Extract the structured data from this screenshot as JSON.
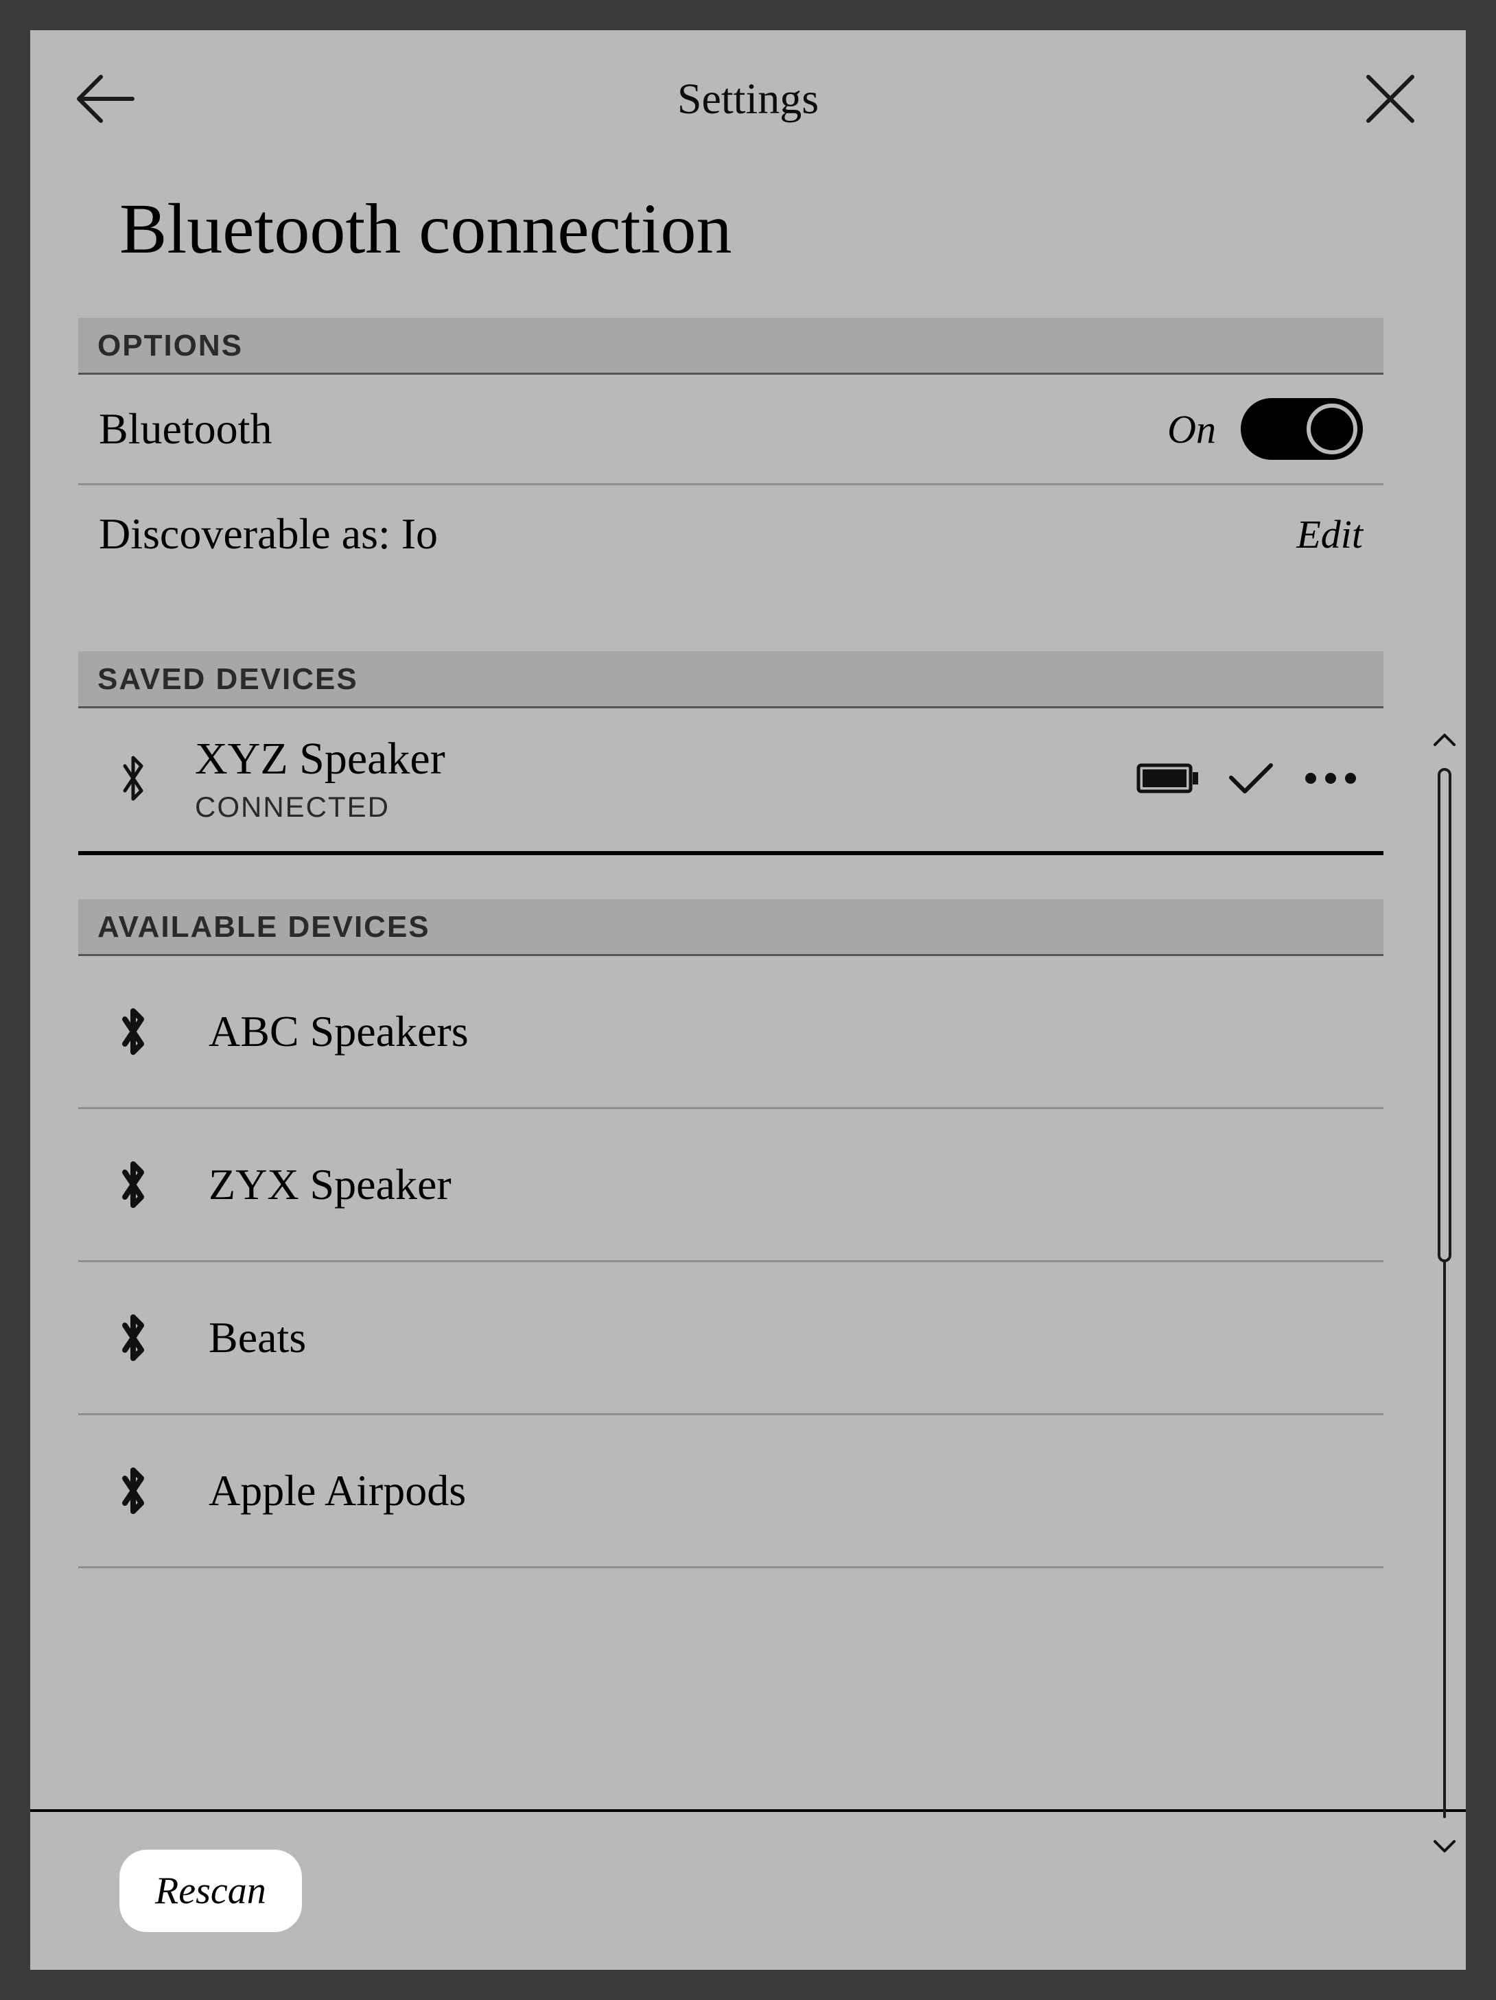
{
  "header": {
    "title": "Settings"
  },
  "page": {
    "title": "Bluetooth connection"
  },
  "sections": {
    "options_label": "OPTIONS",
    "saved_label": "SAVED DEVICES",
    "available_label": "AVAILABLE DEVICES"
  },
  "options": {
    "bluetooth_label": "Bluetooth",
    "bluetooth_state": "On",
    "discoverable_label": "Discoverable as: Io",
    "edit_label": "Edit"
  },
  "saved_devices": [
    {
      "name": "XYZ Speaker",
      "status": "CONNECTED"
    }
  ],
  "available_devices": [
    {
      "name": "ABC Speakers"
    },
    {
      "name": "ZYX Speaker"
    },
    {
      "name": "Beats"
    },
    {
      "name": "Apple Airpods"
    }
  ],
  "footer": {
    "rescan_label": "Rescan"
  }
}
